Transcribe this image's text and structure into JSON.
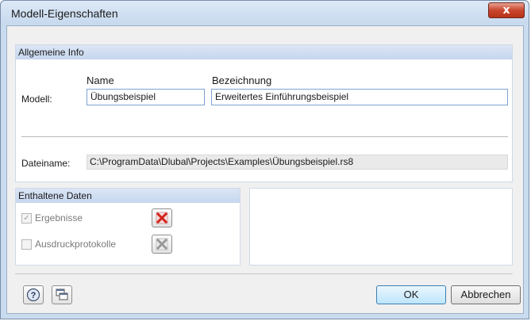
{
  "window": {
    "title": "Modell-Eigenschaften",
    "close_glyph": "x"
  },
  "general": {
    "header": "Allgemeine Info",
    "col_name": "Name",
    "col_description": "Bezeichnung",
    "row_label": "Modell:",
    "name_value": "Übungsbeispiel",
    "description_value": "Erweitertes Einführungsbeispiel",
    "file_label": "Dateiname:",
    "file_value": "C:\\ProgramData\\Dlubal\\Projects\\Examples\\Übungsbeispiel.rs8"
  },
  "contained": {
    "header": "Enthaltene Daten",
    "items": [
      {
        "label": "Ergebnisse",
        "checked": true,
        "delete_icon": "red-x-delete-icon"
      },
      {
        "label": "Ausdruckprotokolle",
        "checked": false,
        "delete_icon": "gray-x-delete-icon"
      }
    ]
  },
  "footer": {
    "help_icon": "help-icon",
    "window_icon": "windows-icon",
    "ok_label": "OK",
    "cancel_label": "Abbrechen"
  },
  "colors": {
    "accent": "#c6d6ee",
    "delete_red": "#d2231d"
  }
}
